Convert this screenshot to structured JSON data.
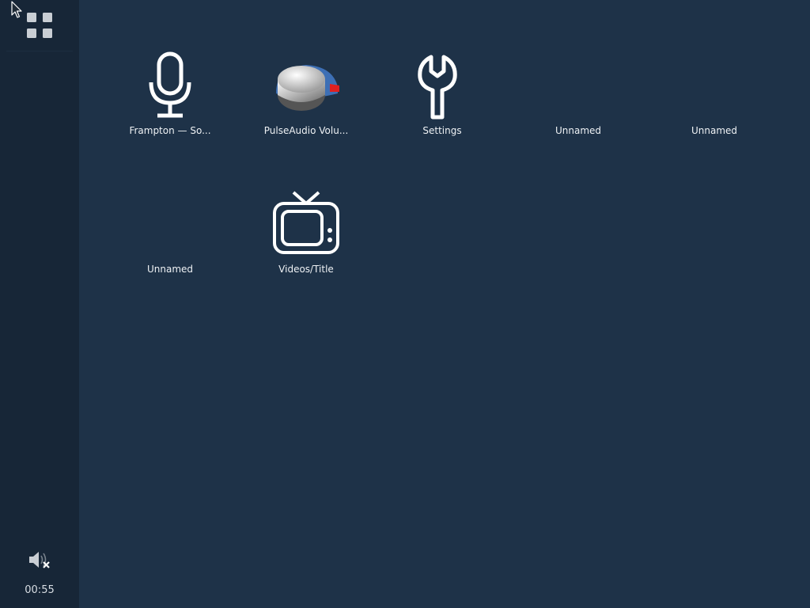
{
  "taskbar": {
    "apps_button_icon": "apps-grid-icon",
    "volume_icon": "volume-muted-icon",
    "clock": "00:55"
  },
  "launcher": {
    "apps": [
      {
        "label": "Frampton — So...",
        "icon": "microphone-icon"
      },
      {
        "label": "PulseAudio Volu...",
        "icon": "volume-knob-icon"
      },
      {
        "label": "Settings",
        "icon": "wrench-icon"
      },
      {
        "label": "Unnamed",
        "icon": ""
      },
      {
        "label": "Unnamed",
        "icon": ""
      },
      {
        "label": "Unnamed",
        "icon": ""
      },
      {
        "label": "Videos/Title",
        "icon": "tv-icon"
      }
    ]
  },
  "colors": {
    "background": "#1e3248",
    "sidebar": "#172637",
    "text": "#eef1f4",
    "knob_accent_blue": "#3d6fb5",
    "knob_accent_red": "#e02020"
  }
}
